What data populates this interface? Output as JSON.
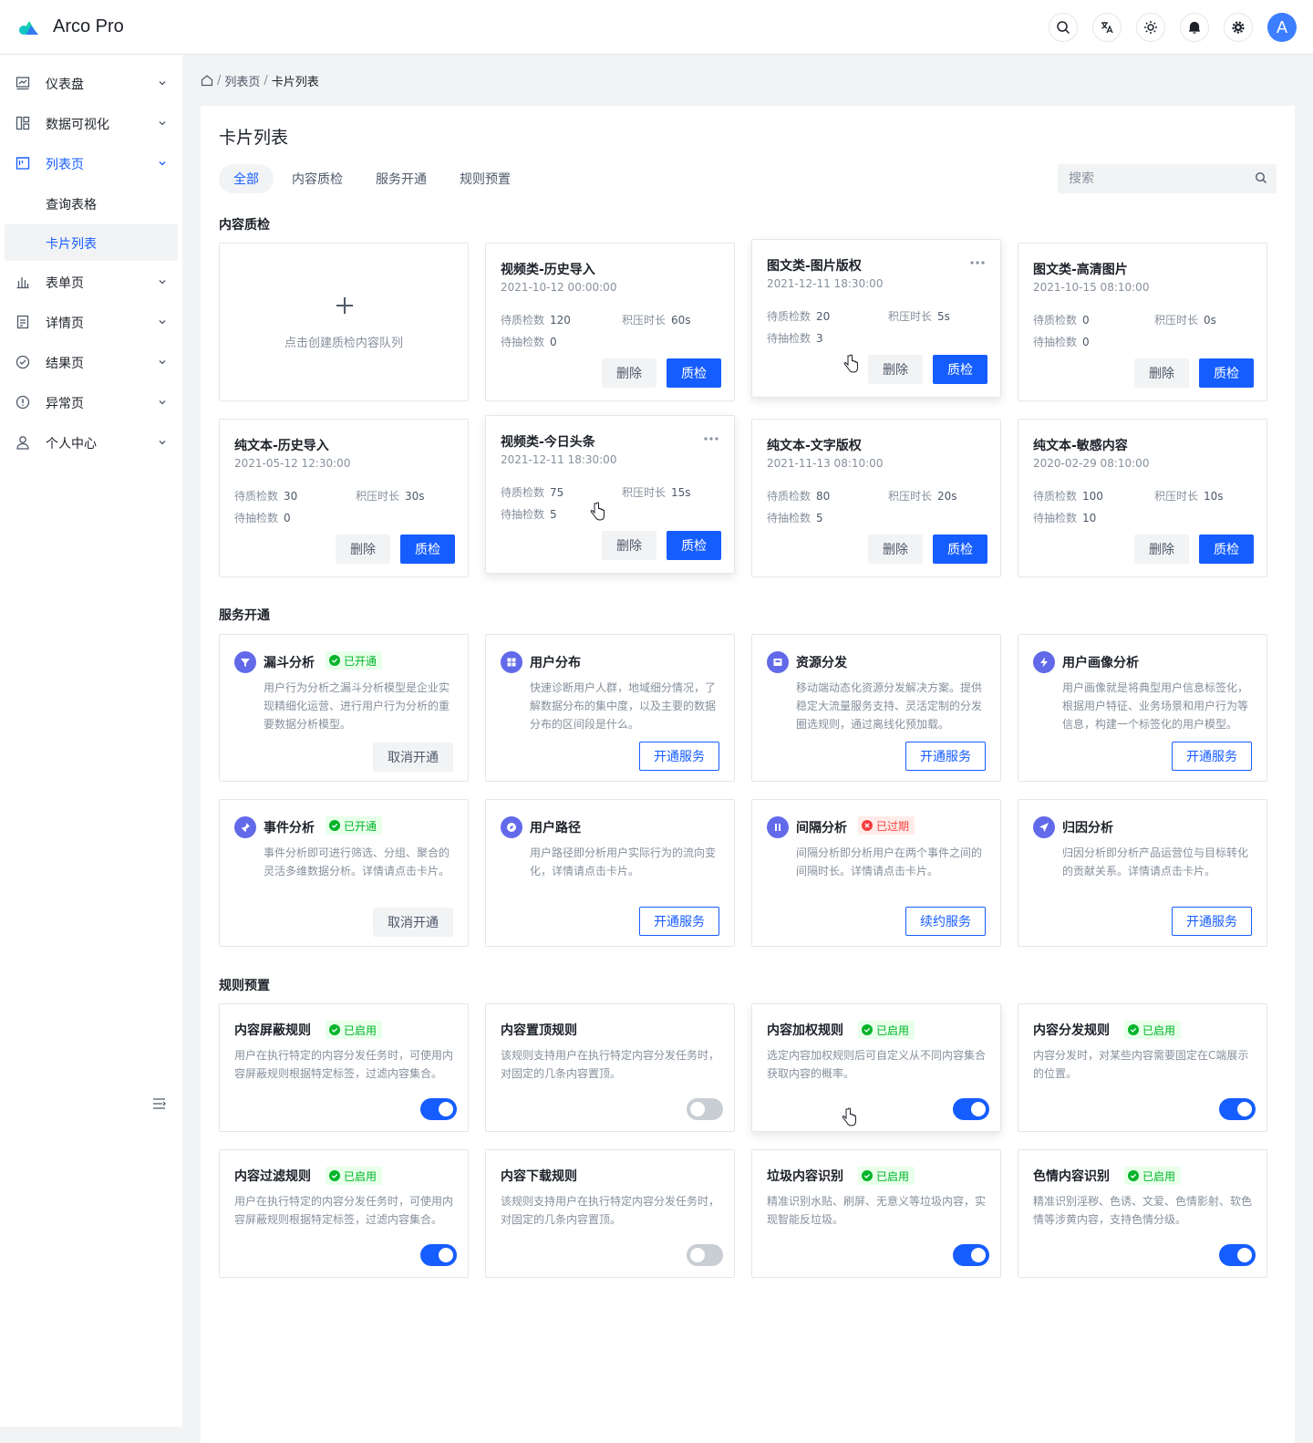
{
  "app": {
    "name": "Arco Pro",
    "avatar_letter": "A"
  },
  "nav_icons": [
    "search-icon",
    "translate-icon",
    "sun-icon",
    "bell-icon",
    "gear-icon"
  ],
  "colors": {
    "primary": "#165dff",
    "success": "#00b42a",
    "danger": "#f53f3f",
    "icon_bg": "#626aea"
  },
  "sidebar": {
    "items": [
      {
        "label": "仪表盘",
        "icon": "dashboard-icon"
      },
      {
        "label": "数据可视化",
        "icon": "layout-icon"
      },
      {
        "label": "列表页",
        "icon": "list-icon",
        "active": true
      },
      {
        "label": "表单页",
        "icon": "bar-chart-icon"
      },
      {
        "label": "详情页",
        "icon": "file-icon"
      },
      {
        "label": "结果页",
        "icon": "check-circle-icon"
      },
      {
        "label": "异常页",
        "icon": "exclamation-circle-icon"
      },
      {
        "label": "个人中心",
        "icon": "user-icon"
      }
    ],
    "subitems": [
      {
        "label": "查询表格"
      },
      {
        "label": "卡片列表",
        "selected": true
      }
    ]
  },
  "breadcrumb": {
    "items": [
      "列表页",
      "卡片列表"
    ]
  },
  "page": {
    "title": "卡片列表",
    "tabs": [
      {
        "label": "全部",
        "active": true
      },
      {
        "label": "内容质检"
      },
      {
        "label": "服务开通"
      },
      {
        "label": "规则预置"
      }
    ],
    "search": {
      "placeholder": "搜索",
      "value": ""
    }
  },
  "inspection": {
    "section_title": "内容质检",
    "add_text": "点击创建质检内容队列",
    "labels": {
      "pending": "待质检数",
      "backlog": "积压时长",
      "sample": "待抽检数",
      "delete": "删除",
      "inspect": "质检"
    },
    "cards": [
      {
        "title": "视频类-历史导入",
        "time": "2021-10-12 00:00:00",
        "pending": "120",
        "backlog": "60s",
        "sample": "0"
      },
      {
        "title": "图文类-图片版权",
        "time": "2021-12-11 18:30:00",
        "pending": "20",
        "backlog": "5s",
        "sample": "3"
      },
      {
        "title": "图文类-高清图片",
        "time": "2021-10-15 08:10:00",
        "pending": "0",
        "backlog": "0s",
        "sample": "0"
      },
      {
        "title": "纯文本-历史导入",
        "time": "2021-05-12 12:30:00",
        "pending": "30",
        "backlog": "30s",
        "sample": "0"
      },
      {
        "title": "视频类-今日头条",
        "time": "2021-12-11 18:30:00",
        "pending": "75",
        "backlog": "15s",
        "sample": "5"
      },
      {
        "title": "纯文本-文字版权",
        "time": "2021-11-13 08:10:00",
        "pending": "80",
        "backlog": "20s",
        "sample": "5"
      },
      {
        "title": "纯文本-敏感内容",
        "time": "2020-02-29 08:10:00",
        "pending": "100",
        "backlog": "10s",
        "sample": "10"
      }
    ]
  },
  "services": {
    "section_title": "服务开通",
    "cards": [
      {
        "title": "漏斗分析",
        "tag": "已开通",
        "tag_type": "green",
        "desc": "用户行为分析之漏斗分析模型是企业实现精细化运营、进行用户行为分析的重要数据分析模型。",
        "action": "取消开通",
        "action_type": "cancel",
        "icon": "funnel-icon"
      },
      {
        "title": "用户分布",
        "tag": "",
        "desc": "快速诊断用户人群，地域细分情况，了解数据分布的集中度，以及主要的数据分布的区间段是什么。",
        "action": "开通服务",
        "action_type": "open",
        "icon": "grid-icon"
      },
      {
        "title": "资源分发",
        "tag": "",
        "desc": "移动端动态化资源分发解决方案。提供稳定大流量服务支持、灵活定制的分发圈选规则，通过离线化预加载。",
        "action": "开通服务",
        "action_type": "open",
        "icon": "box-icon"
      },
      {
        "title": "用户画像分析",
        "tag": "",
        "desc": "用户画像就是将典型用户信息标签化，根据用户特征、业务场景和用户行为等信息，构建一个标签化的用户模型。",
        "action": "开通服务",
        "action_type": "open",
        "icon": "lightning-icon"
      },
      {
        "title": "事件分析",
        "tag": "已开通",
        "tag_type": "green",
        "desc": "事件分析即可进行筛选、分组、聚合的灵活多维数据分析。详情请点击卡片。",
        "action": "取消开通",
        "action_type": "cancel",
        "icon": "pin-icon"
      },
      {
        "title": "用户路径",
        "tag": "",
        "desc": "用户路径即分析用户实际行为的流向变化，详情请点击卡片。",
        "action": "开通服务",
        "action_type": "open",
        "icon": "compass-icon"
      },
      {
        "title": "间隔分析",
        "tag": "已过期",
        "tag_type": "red",
        "desc": "间隔分析即分析用户在两个事件之间的间隔时长。详情请点击卡片。",
        "action": "续约服务",
        "action_type": "open",
        "icon": "pause-icon"
      },
      {
        "title": "归因分析",
        "tag": "",
        "desc": "归因分析即分析产品运营位与目标转化的贡献关系。详情请点击卡片。",
        "action": "开通服务",
        "action_type": "open",
        "icon": "send-icon"
      }
    ]
  },
  "rules": {
    "section_title": "规则预置",
    "cards": [
      {
        "title": "内容屏蔽规则",
        "tag": "已启用",
        "desc": "用户在执行特定的内容分发任务时，可使用内容屏蔽规则根据特定标签，过滤内容集合。",
        "enabled": true
      },
      {
        "title": "内容置顶规则",
        "tag": "",
        "desc": "该规则支持用户在执行特定内容分发任务时，对固定的几条内容置顶。",
        "enabled": false
      },
      {
        "title": "内容加权规则",
        "tag": "已启用",
        "desc": "选定内容加权规则后可自定义从不同内容集合获取内容的概率。",
        "enabled": true
      },
      {
        "title": "内容分发规则",
        "tag": "已启用",
        "desc": "内容分发时，对某些内容需要固定在C端展示的位置。",
        "enabled": true
      },
      {
        "title": "内容过滤规则",
        "tag": "已启用",
        "desc": "用户在执行特定的内容分发任务时，可使用内容屏蔽规则根据特定标签，过滤内容集合。",
        "enabled": true
      },
      {
        "title": "内容下载规则",
        "tag": "",
        "desc": "该规则支持用户在执行特定内容分发任务时，对固定的几条内容置顶。",
        "enabled": false
      },
      {
        "title": "垃圾内容识别",
        "tag": "已启用",
        "desc": "精准识别水贴、刷屏、无意义等垃圾内容，实现智能反垃圾。",
        "enabled": true
      },
      {
        "title": "色情内容识别",
        "tag": "已启用",
        "desc": "精准识别淫秽、色诱、文爱、色情影射、软色情等涉黄内容，支持色情分级。",
        "enabled": true
      }
    ]
  }
}
